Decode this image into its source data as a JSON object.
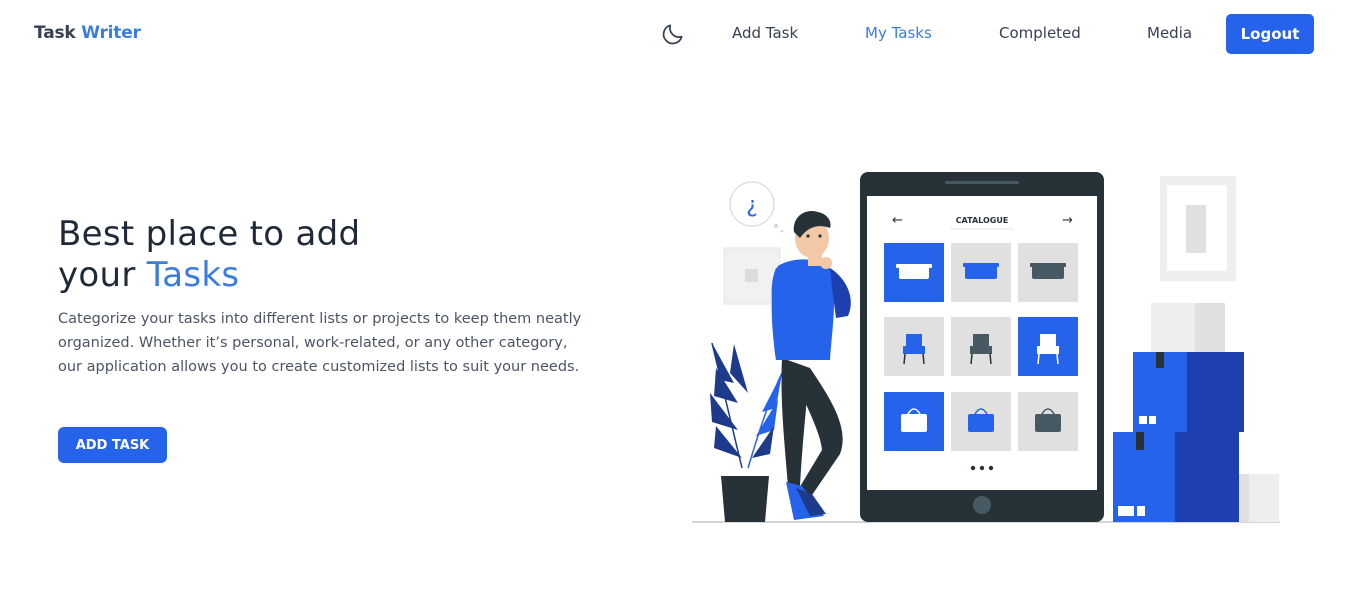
{
  "brand": {
    "part1": "Task",
    "part2": "Writer"
  },
  "nav": {
    "theme_icon": "moon-icon",
    "links": [
      {
        "label": "Add Task",
        "active": false
      },
      {
        "label": "My Tasks",
        "active": true
      },
      {
        "label": "Completed",
        "active": false
      },
      {
        "label": "Media",
        "active": false
      }
    ],
    "logout_label": "Logout"
  },
  "hero": {
    "title_line1": "Best place to add",
    "title_line2_prefix": "your",
    "title_line2_accent": "Tasks",
    "description": "Categorize your tasks into different lists or projects to keep them neatly organized. Whether it’s personal, work-related, or any other category, our application allows you to create customized lists to suit your needs.",
    "cta_label": "ADD TASK"
  },
  "illustration": {
    "screen_title": "CATALOGUE",
    "question_mark": "¿"
  },
  "colors": {
    "primary": "#2563eb",
    "accent_text": "#3b7ddd",
    "dark": "#263238"
  }
}
